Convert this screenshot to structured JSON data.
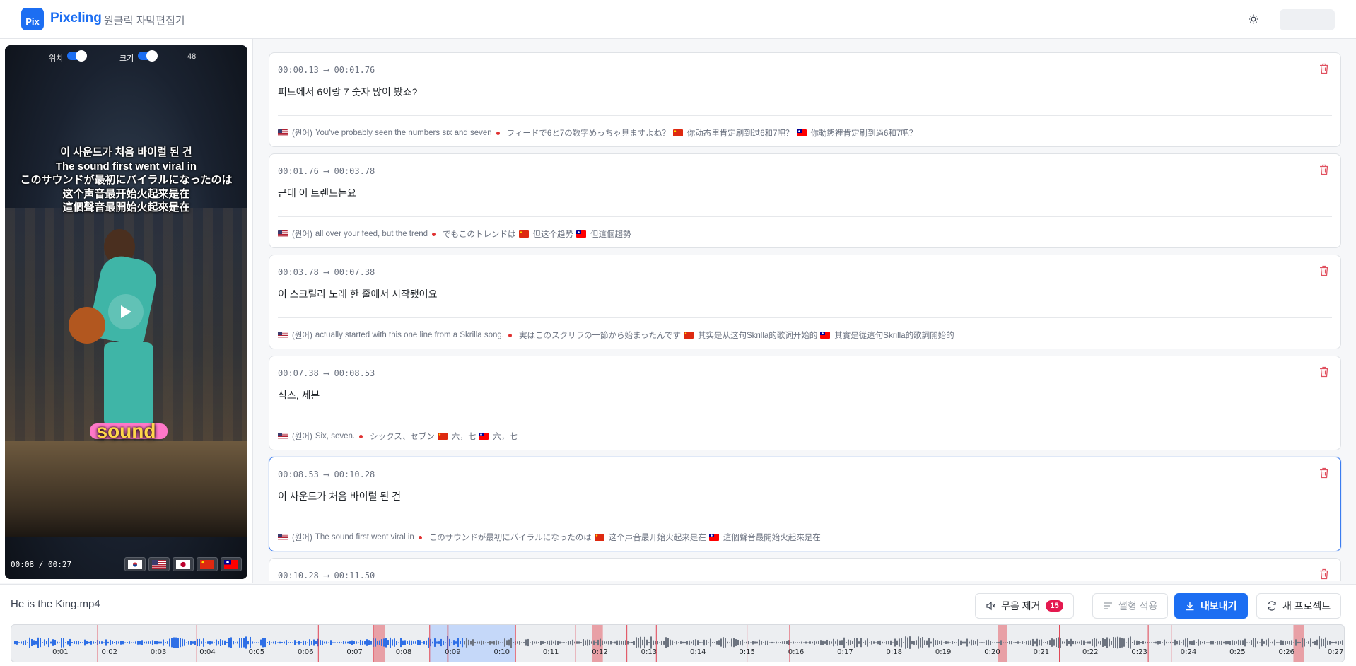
{
  "app": {
    "logo_text": "Pix",
    "name": "Pixeling",
    "subtitle": "원클릭 자막편집기"
  },
  "header": {
    "theme_icon": "sun-icon"
  },
  "player": {
    "position_label": "위치",
    "size_label": "크기",
    "size_value": "48",
    "subtitle_lines": [
      "이 사운드가 처음 바이럴 된 건",
      "The sound first went viral in",
      "このサウンドが最初にバイラルになったのは",
      "这个声音最开始火起来是在",
      "這個聲音最開始火起來是在"
    ],
    "video_word": "sound",
    "time": "00:08 / 00:27",
    "flags": [
      "kr",
      "us",
      "jp",
      "cn",
      "tw"
    ]
  },
  "segments": [
    {
      "time": "00:00.13 ⟶ 00:01.76",
      "text": "피드에서 6이랑 7 숫자 많이 봤죠?",
      "original_label": "(원어)",
      "en": "You've probably seen the numbers six and seven",
      "ja": "フィードで6と7の数字めっちゃ見ますよね？",
      "zh_cn": "你动态里肯定刷到过6和7吧？",
      "zh_tw": "你動態裡肯定刷到過6和7吧？"
    },
    {
      "time": "00:01.76 ⟶ 00:03.78",
      "text": "근데 이 트렌드는요",
      "original_label": "(원어)",
      "en": "all over your feed, but the trend",
      "ja": "でもこのトレンドは",
      "zh_cn": "但这个趋势",
      "zh_tw": "但這個趨勢"
    },
    {
      "time": "00:03.78 ⟶ 00:07.38",
      "text": "이 스크릴라 노래 한 줄에서 시작됐어요",
      "original_label": "(원어)",
      "en": "actually started with this one line from a Skrilla song.",
      "ja": "実はこのスクリラの一節から始まったんです",
      "zh_cn": "其实是从这句Skrilla的歌词开始的",
      "zh_tw": "其實是從這句Skrilla的歌詞開始的"
    },
    {
      "time": "00:07.38 ⟶ 00:08.53",
      "text": "식스, 세븐",
      "original_label": "(원어)",
      "en": "Six, seven.",
      "ja": "シックス、セブン",
      "zh_cn": "六，七",
      "zh_tw": "六，七"
    },
    {
      "time": "00:08.53 ⟶ 00:10.28",
      "text": "이 사운드가 처음 바이럴 된 건",
      "original_label": "(원어)",
      "en": "The sound first went viral in",
      "ja": "このサウンドが最初にバイラルになったのは",
      "zh_cn": "这个声音最开始火起来是在",
      "zh_tw": "這個聲音最開始火起來是在",
      "active": true
    },
    {
      "time": "00:10.28 ⟶ 00:11.50",
      "text": "",
      "original_label": "(원어)",
      "en": "",
      "ja": "",
      "zh_cn": "",
      "zh_tw": ""
    }
  ],
  "footer": {
    "filename": "He is the King.mp4",
    "remove_silence_label": "무음 제거",
    "silence_count": "15",
    "apply_waveform_label": "썰형 적용",
    "export_label": "내보내기",
    "new_project_label": "새 프로젝트"
  },
  "timeline": {
    "ticks": [
      "0:01",
      "0:02",
      "0:03",
      "0:04",
      "0:05",
      "0:06",
      "0:07",
      "0:08",
      "0:09",
      "0:10",
      "0:11",
      "0:12",
      "0:13",
      "0:14",
      "0:15",
      "0:16",
      "0:17",
      "0:18",
      "0:19",
      "0:20",
      "0:21",
      "0:22",
      "0:23",
      "0:24",
      "0:25",
      "0:26",
      "0:27"
    ],
    "duration_s": 27.2,
    "playhead_s": 8.9,
    "selection_s": [
      8.53,
      10.28
    ],
    "silences_s": [
      [
        7.38,
        7.62
      ],
      [
        11.84,
        12.06
      ],
      [
        20.12,
        20.3
      ],
      [
        26.14,
        26.36
      ]
    ],
    "segment_markers_s": [
      1.76,
      3.78,
      6.26,
      7.38,
      8.53,
      10.28,
      11.5,
      12.55,
      13.15,
      15.0,
      15.87,
      21.37,
      23.18,
      23.65
    ],
    "colors": {
      "wave_active": "#2e6fe6",
      "wave_idle": "#6d7480",
      "silence": "#e8a0a6",
      "marker": "#e04050",
      "selection": "#bcd2fb"
    }
  }
}
